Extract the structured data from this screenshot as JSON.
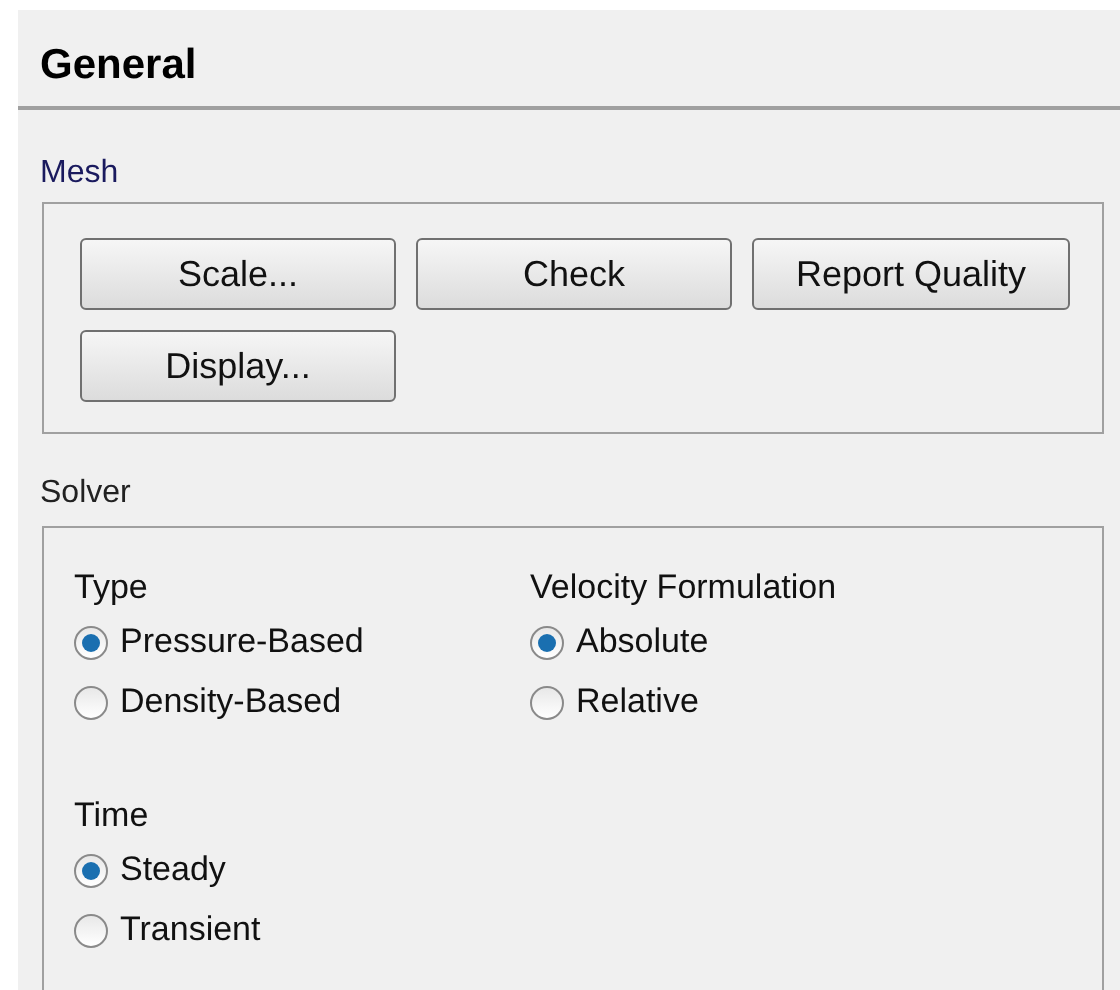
{
  "title": "General",
  "mesh": {
    "label": "Mesh",
    "buttons": [
      "Scale...",
      "Check",
      "Report Quality",
      "Display..."
    ]
  },
  "solver": {
    "label": "Solver",
    "groups": [
      {
        "label": "Type",
        "options": [
          {
            "label": "Pressure-Based",
            "selected": true
          },
          {
            "label": "Density-Based",
            "selected": false
          }
        ]
      },
      {
        "label": "Velocity Formulation",
        "options": [
          {
            "label": "Absolute",
            "selected": true
          },
          {
            "label": "Relative",
            "selected": false
          }
        ]
      },
      {
        "label": "Time",
        "options": [
          {
            "label": "Steady",
            "selected": true
          },
          {
            "label": "Transient",
            "selected": false
          }
        ]
      }
    ]
  }
}
